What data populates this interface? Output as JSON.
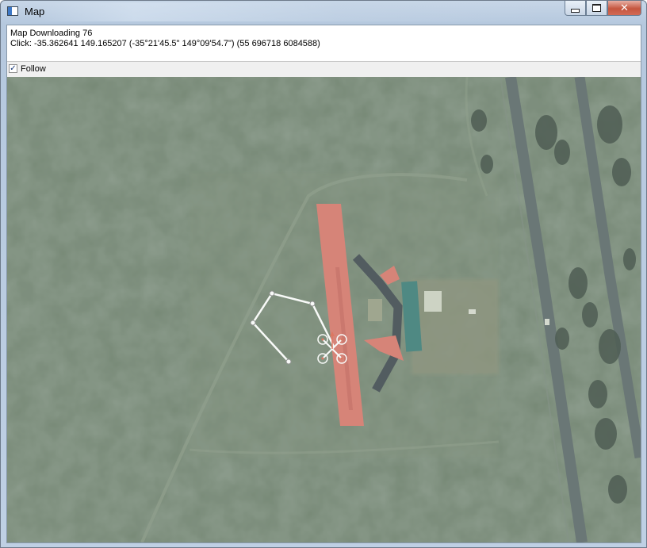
{
  "window": {
    "title": "Map",
    "icon": "app-window-icon",
    "buttons": {
      "minimize": "minimize-icon",
      "maximize": "maximize-icon",
      "close_label": "✕"
    }
  },
  "info": {
    "status": "Map Downloading 76",
    "click": "Click: -35.362641 149.165207 (-35°21'45.5\" 149°09'54.7\") (55 696718 6084588)"
  },
  "follow": {
    "label": "Follow",
    "checked": true,
    "check_glyph": "✓"
  },
  "map": {
    "layer": "satellite-imagery",
    "colors": {
      "ground": "#6b7d6a",
      "runway": "#d9796e",
      "road": "#5e6a6c",
      "flight_path": "#ffffff"
    },
    "vehicle": "quadcopter-icon",
    "waypoints_count": 5
  }
}
